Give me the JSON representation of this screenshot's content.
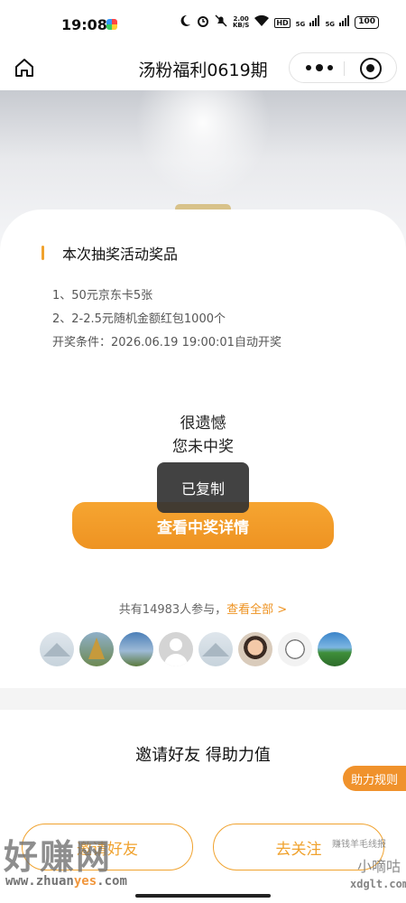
{
  "status_bar": {
    "time": "19:08",
    "speed_value": "2.00",
    "speed_unit": "KB/S",
    "hd": "HD",
    "net1": "5G",
    "net2": "5G",
    "battery": "100"
  },
  "nav": {
    "title": "汤粉福利0619期"
  },
  "prize_section": {
    "title": "本次抽奖活动奖品",
    "items": [
      "1、50元京东卡5张",
      "2、2-2.5元随机金额红包1000个"
    ],
    "condition": "开奖条件：2026.06.19 19:00:01自动开奖"
  },
  "result": {
    "line1": "很遗憾",
    "line2": "您未中奖",
    "detail_button": "查看中奖详情"
  },
  "toast": "已复制",
  "participants": {
    "text": "共有14983人参与，",
    "view_all": "查看全部 >"
  },
  "invite": {
    "title": "邀请好友 得助力值",
    "rules_button": "助力规则",
    "invite_button": "邀请好友",
    "follow_button": "去关注"
  },
  "watermark": {
    "left_text": "好赚网",
    "left_url_a": "www.zhuan",
    "left_url_b": "yes",
    "left_url_c": ".com",
    "right_small": "赚钱羊毛线报",
    "right_name": "小嘀咕",
    "right_url": "xdglt.com"
  },
  "colors": {
    "accent": "#f0a22e",
    "button_orange": "#ee9322",
    "toast_bg": "#323232"
  }
}
